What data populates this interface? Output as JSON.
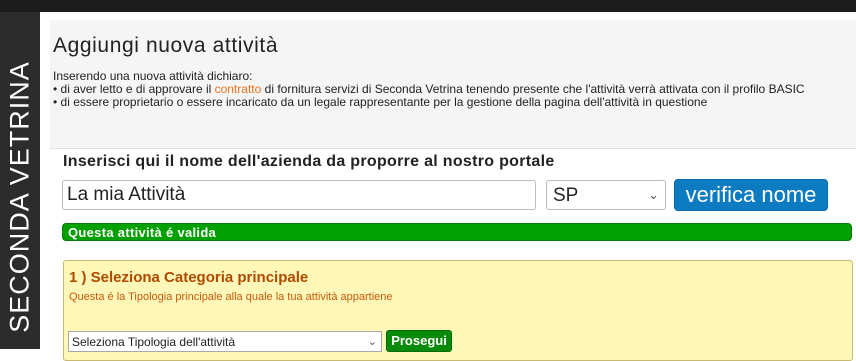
{
  "sidebar": {
    "brand": "SECONDA VETRINA"
  },
  "header": {
    "title": "Aggiungi nuova attività",
    "intro_line1": "Inserendo una nuova attività dichiaro:",
    "intro_line2_pre": "• di aver letto e di approvare il ",
    "intro_line2_link": "contratto",
    "intro_line2_post": " di fornitura servizi di Seconda Vetrina tenendo presente che l'attività verrà attivata con il profilo BASIC",
    "intro_line3": "• di essere proprietario o essere incaricato da un legale rappresentante per la gestione della pagina dell'attività in questione"
  },
  "form": {
    "section_title": "Inserisci qui il nome dell'azienda da proporre al nostro portale",
    "name_value": "La mia Attività",
    "province_value": "SP",
    "verify_label": "verifica nome",
    "valid_message": "Questa attività é valida"
  },
  "category": {
    "title": "1 ) Seleziona Categoria principale",
    "subtitle": "Questa é la Tipologia principale alla quale la tua attività appartiene",
    "select_value": "Seleziona Tipologia dell'attività",
    "next_label": "Prosegui"
  },
  "colors": {
    "accent_blue": "#0c7bc2",
    "valid_green": "#00a000",
    "link_orange": "#e8731c",
    "category_bg": "#fef7b7"
  },
  "icons": {
    "select_chevron": "chevron-down-icon"
  }
}
